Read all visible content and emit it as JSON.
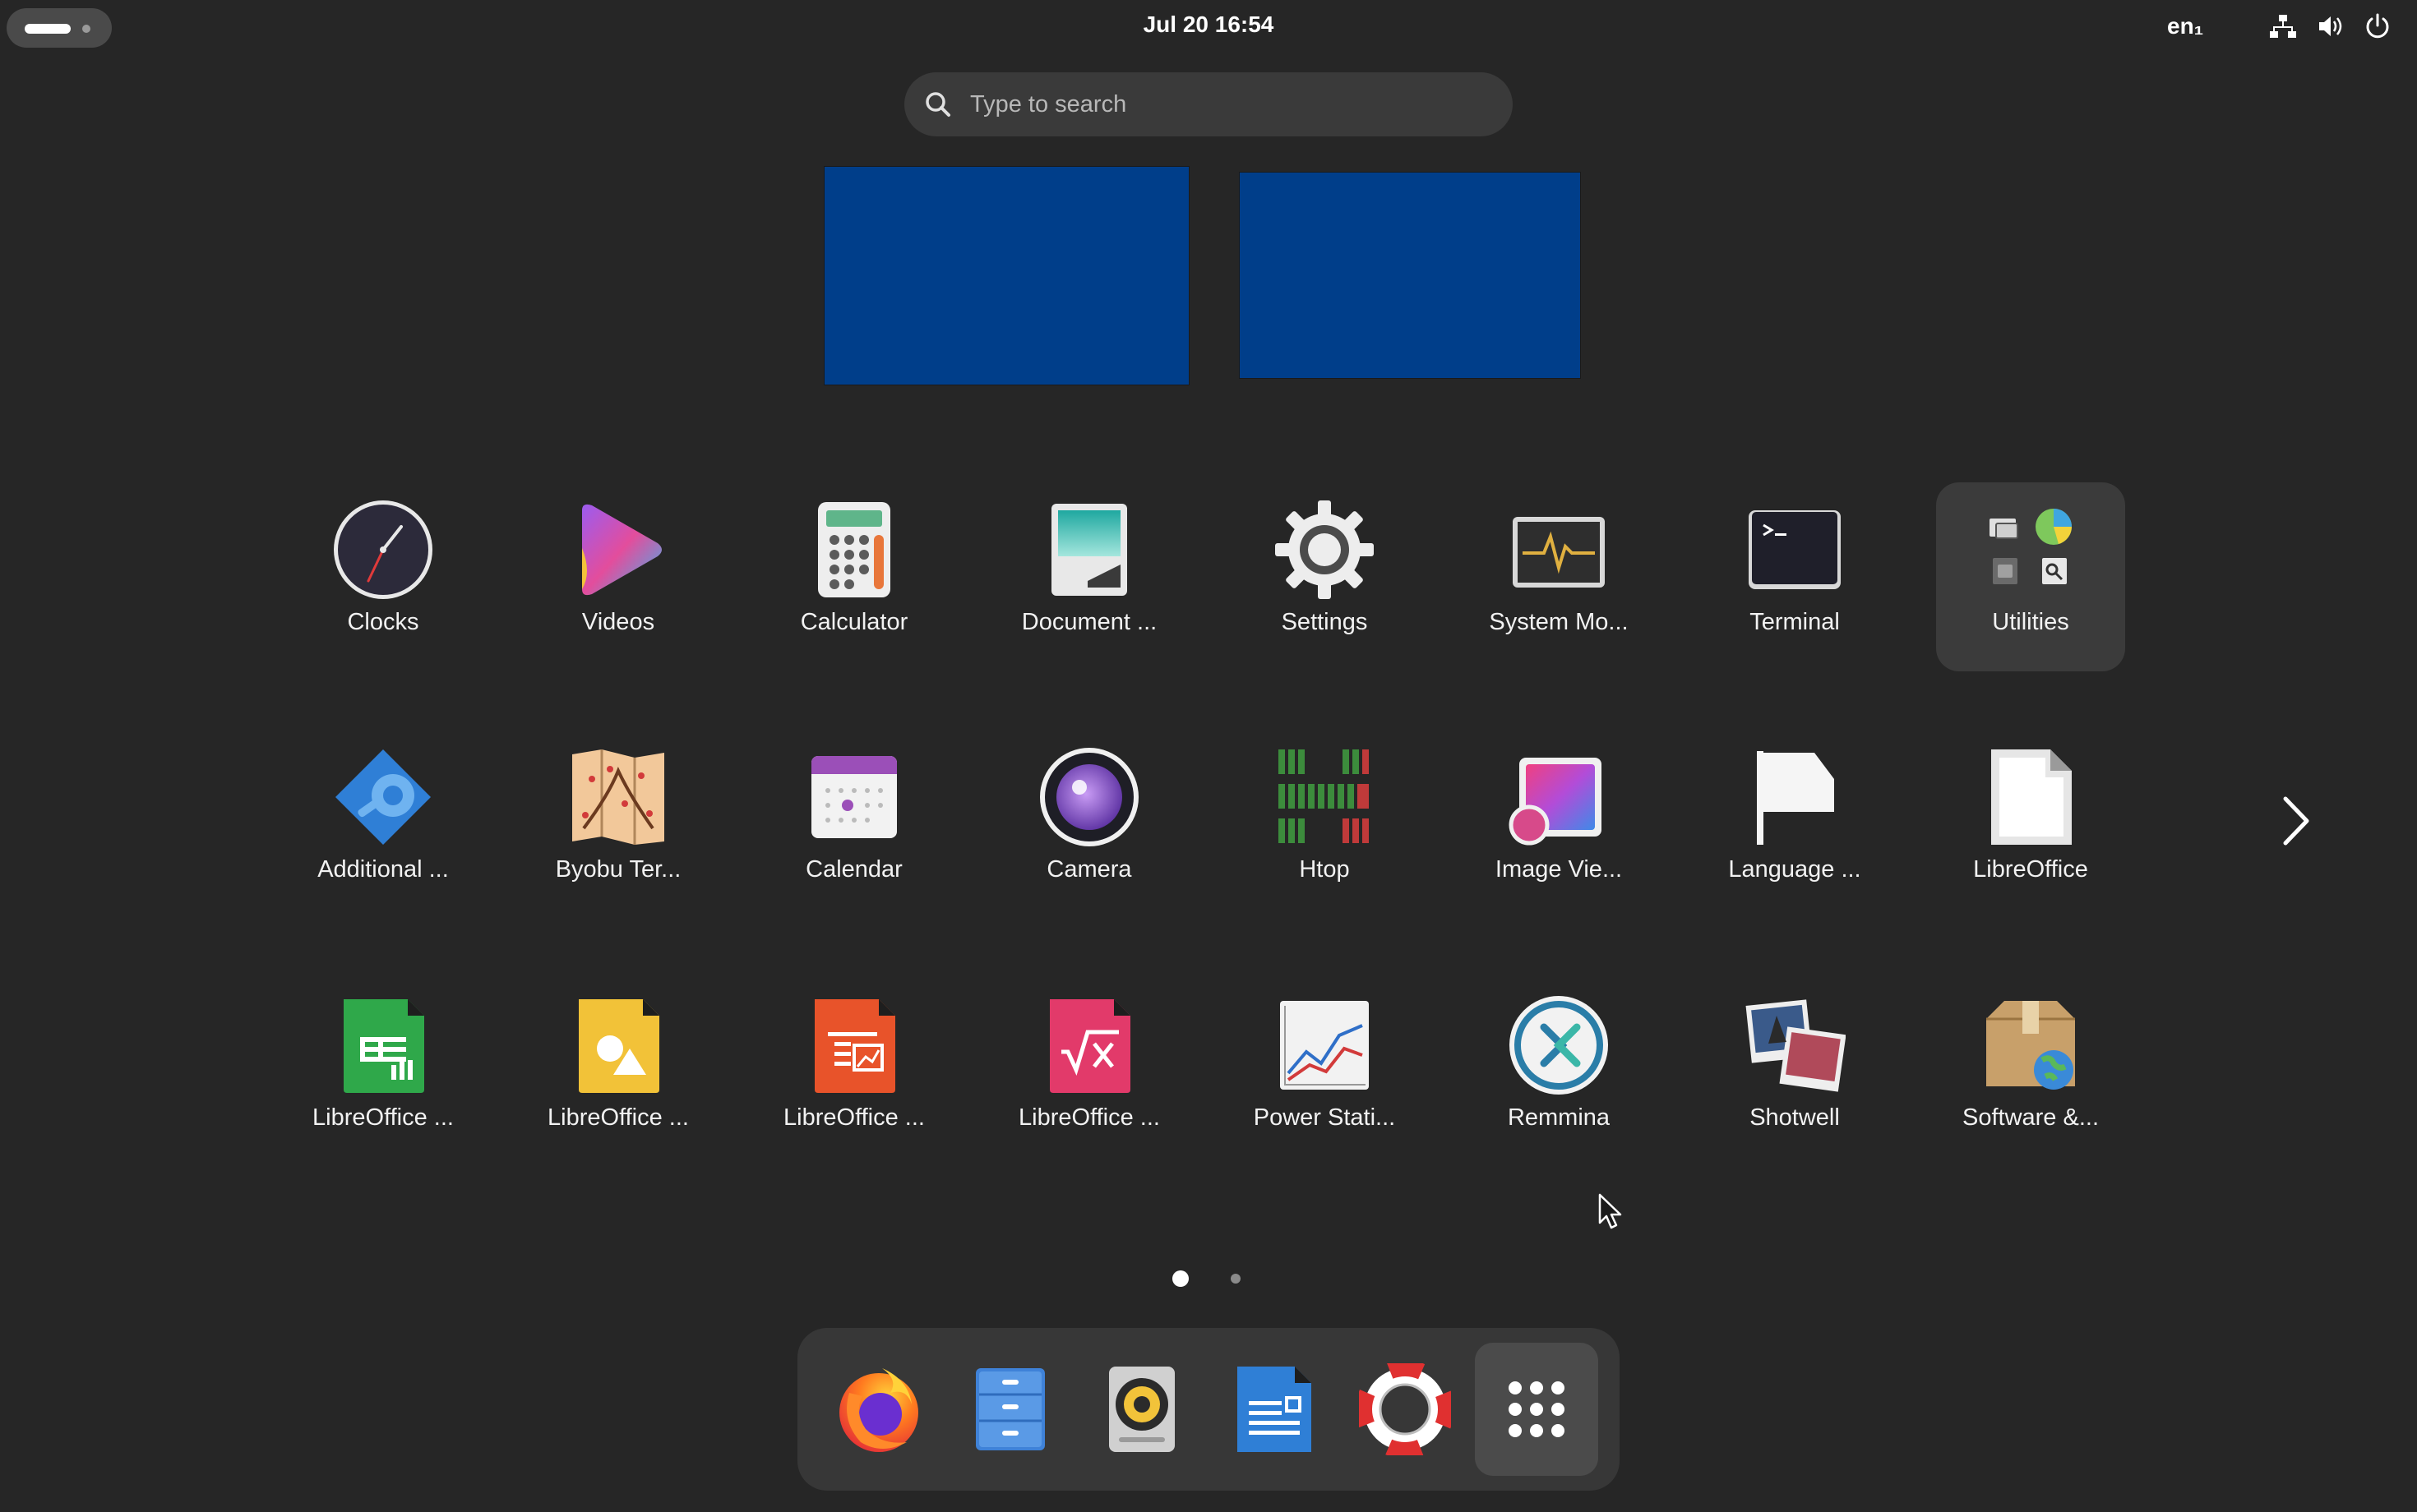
{
  "topbar": {
    "datetime": "Jul 20  16:54",
    "keyboard_layout": "en₁"
  },
  "search": {
    "placeholder": "Type to search"
  },
  "workspaces": [
    "workspace-1",
    "workspace-2"
  ],
  "colors": {
    "background": "#262626",
    "workspace": "#003e8a",
    "search_bg": "#3a3a3a",
    "dock_bg": "#373737",
    "folder_bg": "#3b3b3b"
  },
  "apps": [
    {
      "label": "Clocks",
      "icon": "clock-icon"
    },
    {
      "label": "Videos",
      "icon": "videos-icon"
    },
    {
      "label": "Calculator",
      "icon": "calculator-icon"
    },
    {
      "label": "Document ...",
      "icon": "document-scanner-icon"
    },
    {
      "label": "Settings",
      "icon": "gear-icon"
    },
    {
      "label": "System Mo...",
      "icon": "system-monitor-icon"
    },
    {
      "label": "Terminal",
      "icon": "terminal-icon"
    },
    {
      "label": "Utilities",
      "icon": "utilities-folder-icon"
    },
    {
      "label": "Additional ...",
      "icon": "additional-drivers-icon"
    },
    {
      "label": "Byobu Ter...",
      "icon": "byobu-map-icon"
    },
    {
      "label": "Calendar",
      "icon": "calendar-icon"
    },
    {
      "label": "Camera",
      "icon": "camera-icon"
    },
    {
      "label": "Htop",
      "icon": "htop-icon"
    },
    {
      "label": "Image Vie...",
      "icon": "image-viewer-icon"
    },
    {
      "label": "Language ...",
      "icon": "flag-icon"
    },
    {
      "label": "LibreOffice",
      "icon": "libreoffice-icon"
    },
    {
      "label": "LibreOffice ...",
      "icon": "libreoffice-calc-icon"
    },
    {
      "label": "LibreOffice ...",
      "icon": "libreoffice-draw-icon"
    },
    {
      "label": "LibreOffice ...",
      "icon": "libreoffice-impress-icon"
    },
    {
      "label": "LibreOffice ...",
      "icon": "libreoffice-math-icon"
    },
    {
      "label": "Power Stati...",
      "icon": "power-statistics-icon"
    },
    {
      "label": "Remmina",
      "icon": "remmina-icon"
    },
    {
      "label": "Shotwell",
      "icon": "shotwell-icon"
    },
    {
      "label": "Software &...",
      "icon": "software-updates-icon"
    }
  ],
  "pagination": {
    "current": 1,
    "total": 2
  },
  "dock": [
    "firefox-icon",
    "files-icon",
    "rhythmbox-icon",
    "libreoffice-writer-icon",
    "help-icon",
    "app-grid-icon"
  ]
}
